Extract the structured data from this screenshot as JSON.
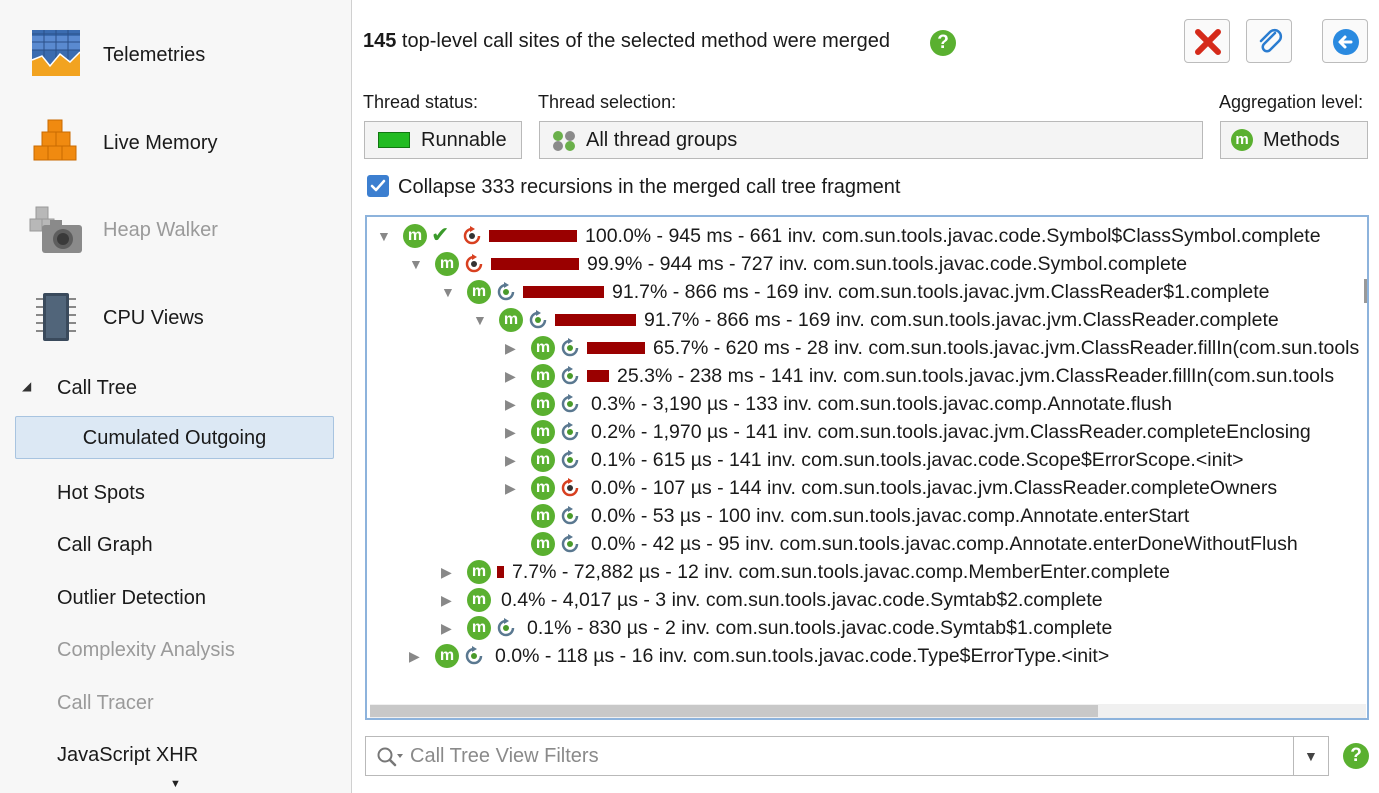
{
  "sidebar": {
    "views": [
      {
        "label": "Telemetries",
        "icon": "telemetries-icon",
        "disabled": false
      },
      {
        "label": "Live Memory",
        "icon": "live-memory-icon",
        "disabled": false
      },
      {
        "label": "Heap Walker",
        "icon": "heap-walker-icon",
        "disabled": true
      },
      {
        "label": "CPU Views",
        "icon": "cpu-views-icon",
        "disabled": false
      }
    ],
    "section": "Call Tree",
    "selected": "Cumulated Outgoing",
    "items": [
      {
        "label": "Hot Spots",
        "disabled": false
      },
      {
        "label": "Call Graph",
        "disabled": false
      },
      {
        "label": "Outlier Detection",
        "disabled": false
      },
      {
        "label": "Complexity Analysis",
        "disabled": true
      },
      {
        "label": "Call Tracer",
        "disabled": true
      },
      {
        "label": "JavaScript XHR",
        "disabled": false
      }
    ]
  },
  "header": {
    "count": "145",
    "text": " top-level call sites of the selected method were merged"
  },
  "controls": {
    "thread_status_label": "Thread status:",
    "thread_status_value": "Runnable",
    "thread_selection_label": "Thread selection:",
    "thread_selection_value": "All thread groups",
    "aggregation_label": "Aggregation level:",
    "aggregation_value": "Methods",
    "collapse_label": "Collapse 333 recursions in the merged call tree fragment",
    "collapse_checked": true
  },
  "tree": [
    {
      "text": "100.0% - 945 ms - 661 inv. com.sun.tools.javac.code.Symbol$ClassSymbol.complete",
      "expanded": true,
      "has_children": true,
      "pct": 100.0,
      "check": true,
      "cycle": "red"
    },
    {
      "text": "99.9% - 944 ms - 727 inv. com.sun.tools.javac.code.Symbol.complete",
      "expanded": true,
      "has_children": true,
      "pct": 99.9,
      "check": false,
      "cycle": "red"
    },
    {
      "text": "91.7% - 866 ms - 169 inv. com.sun.tools.javac.jvm.ClassReader$1.complete",
      "expanded": true,
      "has_children": true,
      "pct": 91.7,
      "check": false,
      "cycle": "blue"
    },
    {
      "text": "91.7% - 866 ms - 169 inv. com.sun.tools.javac.jvm.ClassReader.complete",
      "expanded": true,
      "has_children": true,
      "pct": 91.7,
      "check": false,
      "cycle": "blue"
    },
    {
      "text": "65.7% - 620 ms - 28 inv. com.sun.tools.javac.jvm.ClassReader.fillIn(com.sun.tools",
      "expanded": false,
      "has_children": true,
      "pct": 65.7,
      "check": false,
      "cycle": "blue"
    },
    {
      "text": "25.3% - 238 ms - 141 inv. com.sun.tools.javac.jvm.ClassReader.fillIn(com.sun.tools",
      "expanded": false,
      "has_children": true,
      "pct": 25.3,
      "check": false,
      "cycle": "blue"
    },
    {
      "text": "0.3% - 3,190 µs - 133 inv. com.sun.tools.javac.comp.Annotate.flush",
      "expanded": false,
      "has_children": true,
      "pct": 0.3,
      "check": false,
      "cycle": "blue"
    },
    {
      "text": "0.2% - 1,970 µs - 141 inv. com.sun.tools.javac.jvm.ClassReader.completeEnclosing",
      "expanded": false,
      "has_children": true,
      "pct": 0.2,
      "check": false,
      "cycle": "blue"
    },
    {
      "text": "0.1% - 615 µs - 141 inv. com.sun.tools.javac.code.Scope$ErrorScope.<init>",
      "expanded": false,
      "has_children": true,
      "pct": 0.1,
      "check": false,
      "cycle": "blue"
    },
    {
      "text": "0.0% - 107 µs - 144 inv. com.sun.tools.javac.jvm.ClassReader.completeOwners",
      "expanded": false,
      "has_children": true,
      "pct": 0.0,
      "check": false,
      "cycle": "red"
    },
    {
      "text": "0.0% - 53 µs - 100 inv. com.sun.tools.javac.comp.Annotate.enterStart",
      "expanded": false,
      "has_children": false,
      "pct": 0.0,
      "check": false,
      "cycle": "blue"
    },
    {
      "text": "0.0% - 42 µs - 95 inv. com.sun.tools.javac.comp.Annotate.enterDoneWithoutFlush",
      "expanded": false,
      "has_children": false,
      "pct": 0.0,
      "check": false,
      "cycle": "blue"
    },
    {
      "text": "7.7% - 72,882 µs - 12 inv. com.sun.tools.javac.comp.MemberEnter.complete",
      "expanded": false,
      "has_children": true,
      "pct": 7.7,
      "check": false,
      "cycle": "none"
    },
    {
      "text": "0.4% - 4,017 µs - 3 inv. com.sun.tools.javac.code.Symtab$2.complete",
      "expanded": false,
      "has_children": true,
      "pct": 0.4,
      "check": false,
      "cycle": "none"
    },
    {
      "text": "0.1% - 830 µs - 2 inv. com.sun.tools.javac.code.Symtab$1.complete",
      "expanded": false,
      "has_children": true,
      "pct": 0.1,
      "check": false,
      "cycle": "blue"
    },
    {
      "text": "0.0% - 118 µs - 16 inv. com.sun.tools.javac.code.Type$ErrorType.<init>",
      "expanded": false,
      "has_children": true,
      "pct": 0.0,
      "check": false,
      "cycle": "blue"
    }
  ],
  "filter": {
    "placeholder": "Call Tree View Filters"
  },
  "colors": {
    "accent_green": "#5ab030",
    "bar_red": "#9a0000",
    "selection_blue": "#dce8f4"
  }
}
